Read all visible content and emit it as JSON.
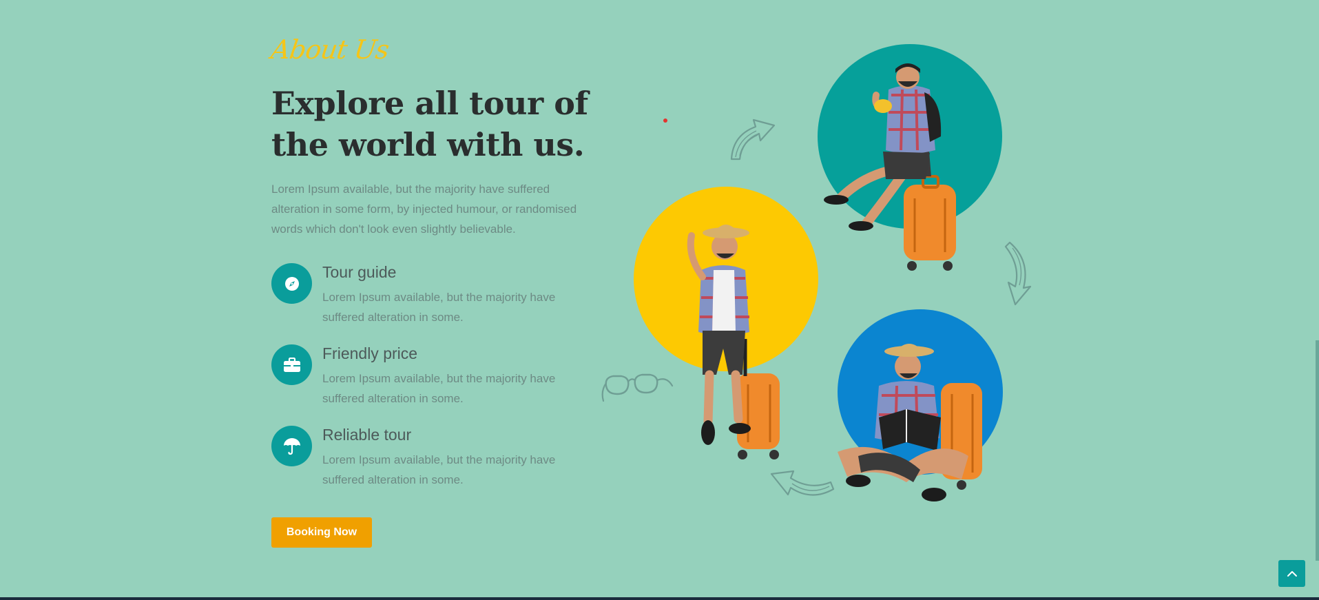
{
  "about": {
    "script_label": "About Us",
    "headline": "Explore all tour of the world with us.",
    "intro": "Lorem Ipsum available, but the majority have suffered alteration in some form, by injected humour, or randomised words which don't look even slightly believable."
  },
  "features": [
    {
      "icon": "compass-icon",
      "title": "Tour guide",
      "desc": "Lorem Ipsum available, but the majority have suffered alteration in some."
    },
    {
      "icon": "briefcase-icon",
      "title": "Friendly price",
      "desc": "Lorem Ipsum available, but the majority have suffered alteration in some."
    },
    {
      "icon": "umbrella-icon",
      "title": "Reliable tour",
      "desc": "Lorem Ipsum available, but the majority have suffered alteration in some."
    }
  ],
  "cta": {
    "label": "Booking Now"
  },
  "colors": {
    "background": "#95d1bc",
    "accent_teal": "#0a9d9b",
    "accent_yellow": "#fdc902",
    "accent_blue": "#0b85d0",
    "button_orange": "#f0a000",
    "script_yellow": "#f5c518"
  },
  "scroll_top": {
    "icon": "chevron-up-icon"
  }
}
